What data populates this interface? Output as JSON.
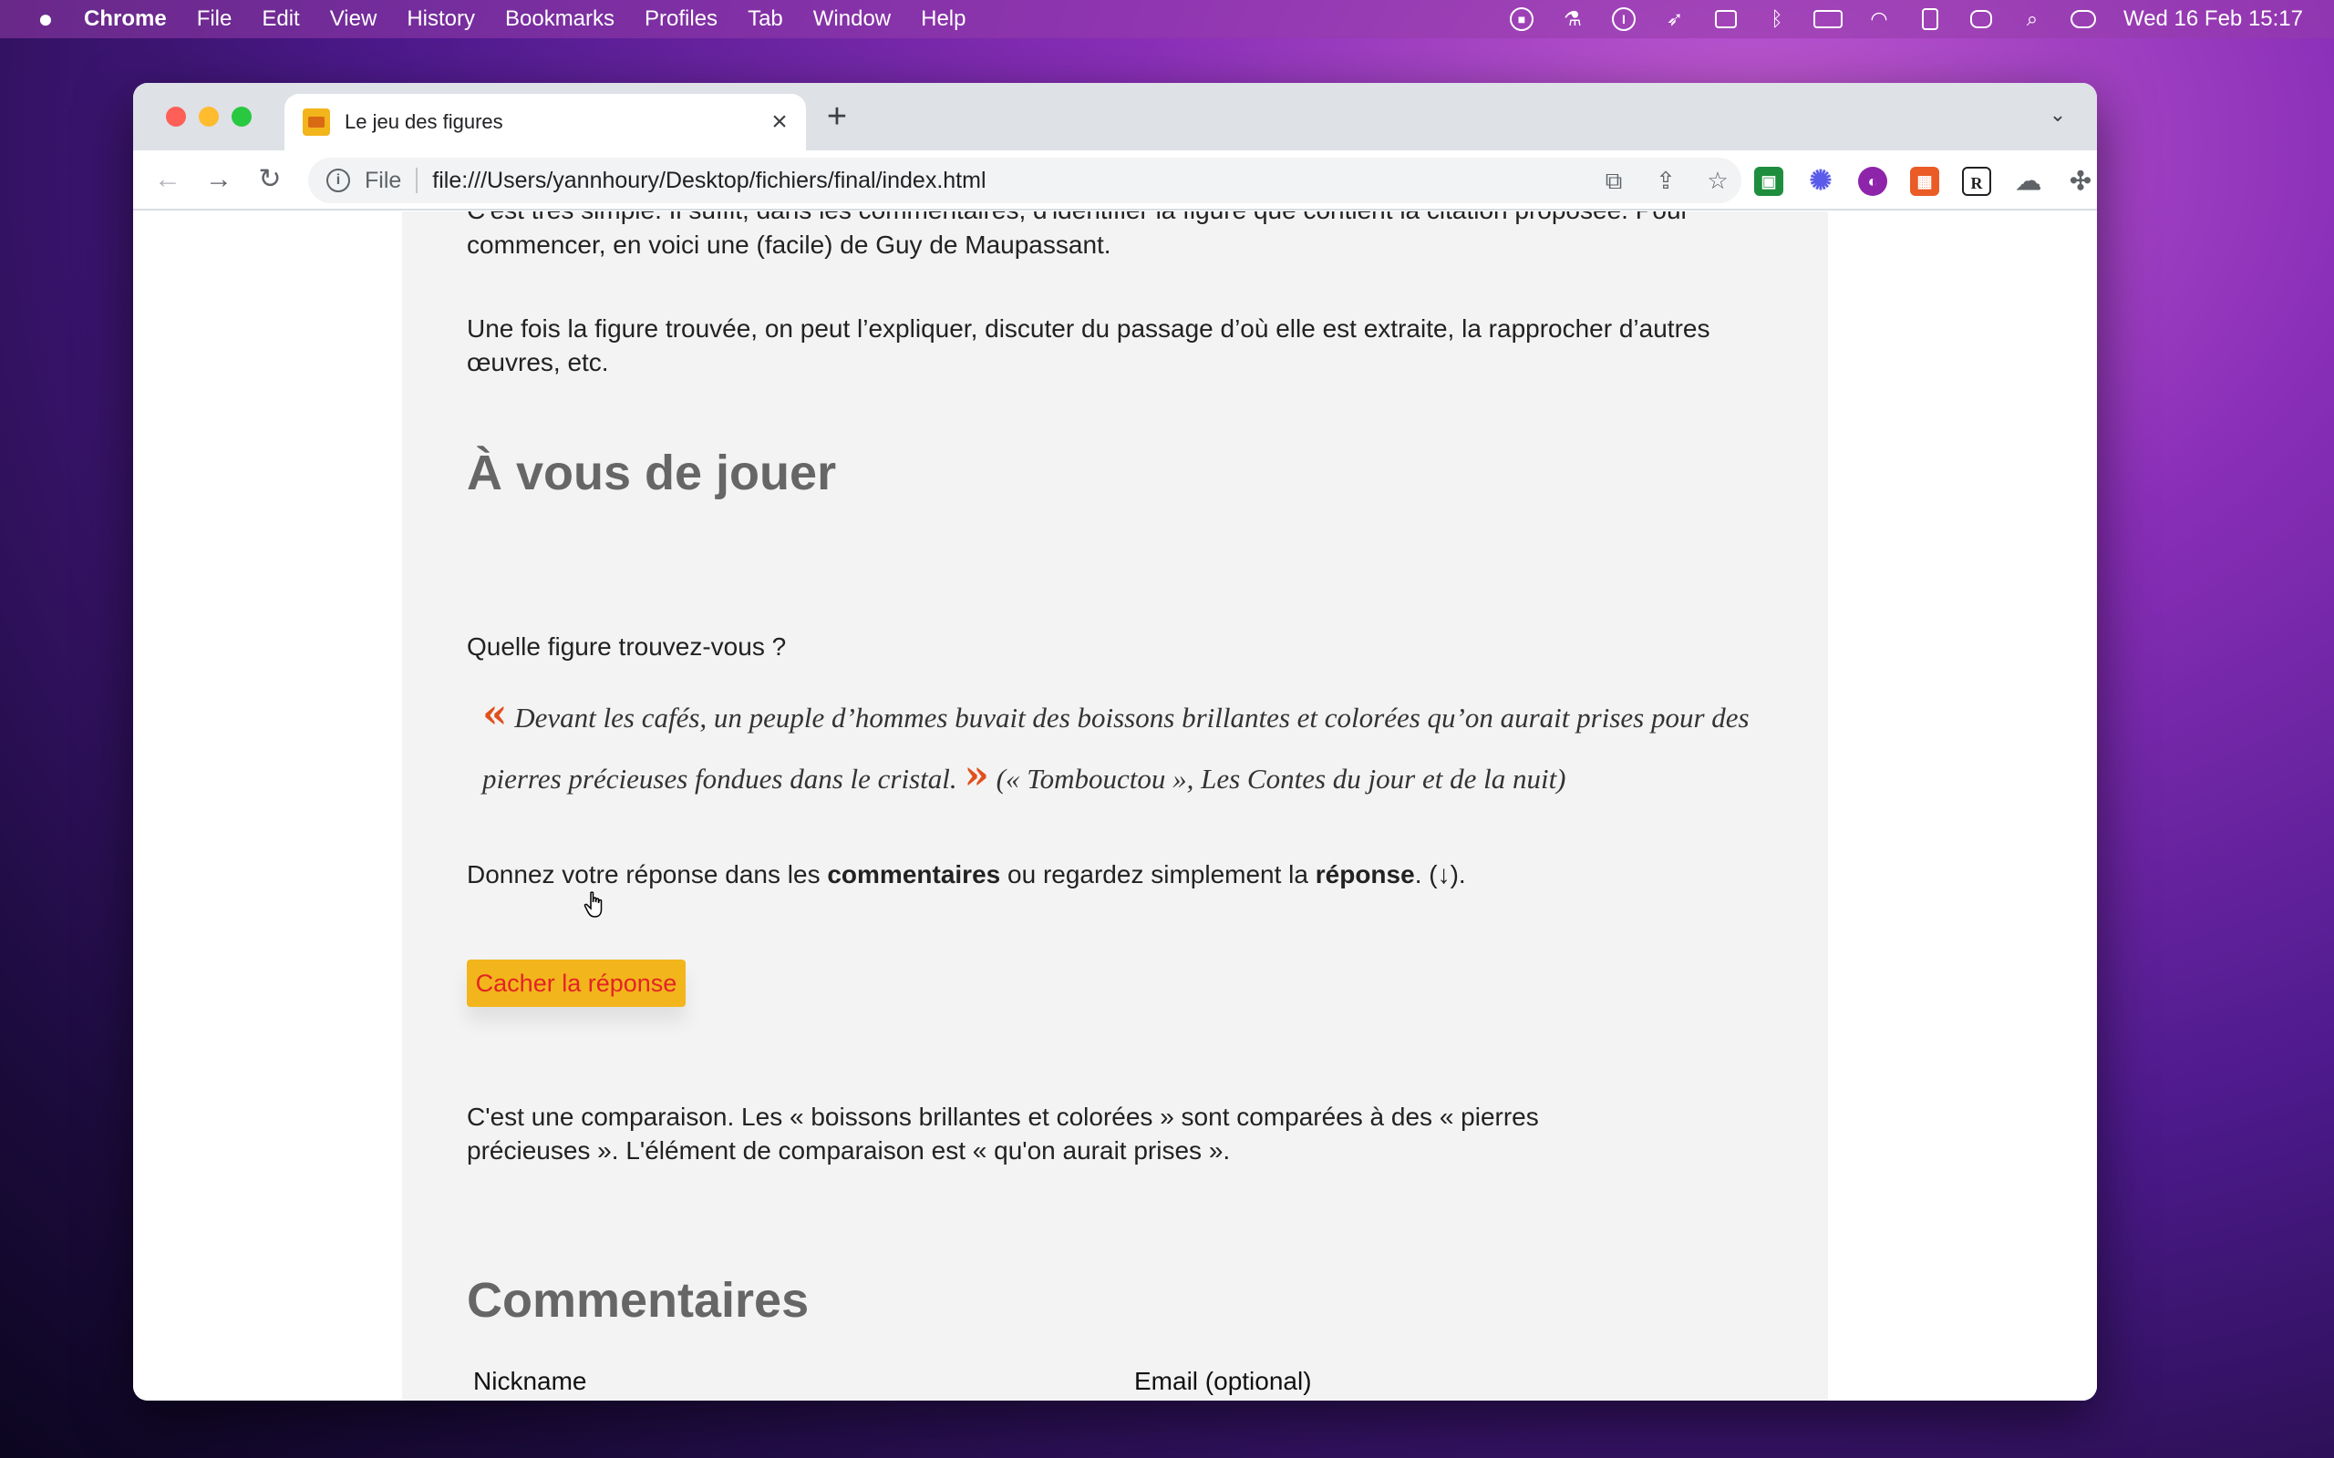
{
  "menubar": {
    "app": "Chrome",
    "items": [
      "File",
      "Edit",
      "View",
      "History",
      "Bookmarks",
      "Profiles",
      "Tab",
      "Window",
      "Help"
    ],
    "clock": "Wed 16 Feb  15:17"
  },
  "tab": {
    "title": "Le jeu des figures",
    "close": "×",
    "new": "+"
  },
  "toolbar": {
    "scheme": "File",
    "url": "file:///Users/yannhoury/Desktop/fichiers/final/index.html"
  },
  "page": {
    "cut_line": "C'est très simple. Il suffit, dans les commentaires, d'identifier la figure que contient la citation proposée. Pour",
    "intro_line2": "commencer, en voici une (facile) de Guy de Maupassant.",
    "para2_line1": "Une fois la figure trouvée, on peut l’expliquer, discuter du passage d’où elle est extraite, la rapprocher d’autres",
    "para2_line2": "œuvres, etc.",
    "heading_play": "À vous de jouer",
    "question": "Quelle figure trouvez-vous ?",
    "quote_open": "«",
    "quote_text": "Devant les cafés, un peuple d’hommes buvait des boissons brillantes et colorées qu’on aurait prises pour des pierres précieuses fondues dans le cristal.",
    "quote_close": "»",
    "quote_source": "(« Tombouctou », Les Contes du jour et de la nuit)",
    "instruction_pre": "Donnez votre réponse dans les ",
    "instruction_bold1": "commentaires",
    "instruction_mid": " ou regardez simplement la ",
    "instruction_bold2": "réponse",
    "instruction_post": ". (↓).",
    "button": "Cacher la réponse",
    "answer_line1": "C'est une comparaison. Les « boissons brillantes et colorées » sont comparées à des « pierres",
    "answer_line2": "précieuses ». L'élément de comparaison est « qu'on aurait prises ».",
    "heading_comments": "Commentaires",
    "label_nickname": "Nickname",
    "label_email": "Email (optional)"
  },
  "colors": {
    "accent_button": "#f2b51c",
    "button_text": "#e32424",
    "quote_marks": "#e0501c"
  }
}
